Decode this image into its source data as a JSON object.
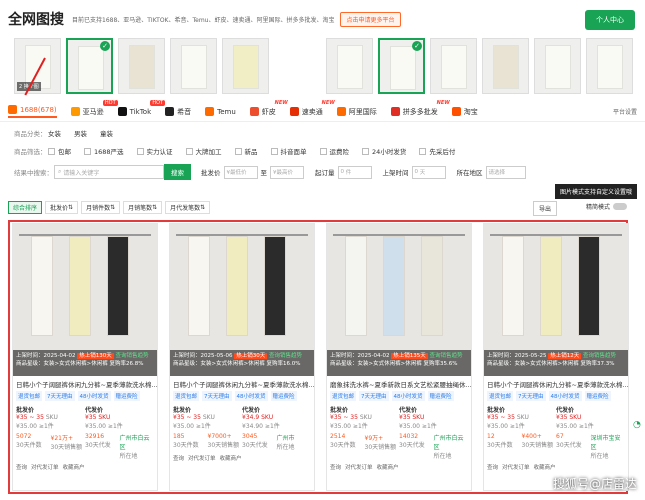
{
  "header": {
    "logo": "全网图搜",
    "tagline": "目前已支持1688、亚马逊、TIKTOK、希音、Temu、虾皮、速卖通、阿里国际、拼多多批发、淘宝",
    "apply": "点击申请更多平台",
    "user_center": "个人中心"
  },
  "thumbs_left": [
    {
      "caption": "",
      "selected": false
    },
    {
      "caption": "",
      "selected": true
    },
    {
      "caption": "",
      "selected": false
    },
    {
      "caption": "",
      "selected": false
    },
    {
      "caption": "",
      "selected": false
    }
  ],
  "thumbs_left_caption": "2 换个图",
  "thumbs_right": [
    {
      "selected": false
    },
    {
      "selected": true
    },
    {
      "selected": false
    },
    {
      "selected": false
    },
    {
      "selected": false
    },
    {
      "selected": false
    },
    {
      "selected": false
    }
  ],
  "platforms": [
    {
      "label": "1688(678)",
      "active": true,
      "badge": "",
      "color": "#ff6a00"
    },
    {
      "label": "亚马逊",
      "badge": "HOT",
      "color": "#ff9900"
    },
    {
      "label": "TikTok",
      "badge": "HOT",
      "color": "#111111"
    },
    {
      "label": "希音",
      "badge": "",
      "color": "#222222"
    },
    {
      "label": "Temu",
      "badge": "",
      "color": "#ff6a00"
    },
    {
      "label": "虾皮",
      "badge": "NEW",
      "color": "#ee4d2d"
    },
    {
      "label": "速卖通",
      "badge": "NEW",
      "color": "#e62e04"
    },
    {
      "label": "阿里国际",
      "badge": "",
      "color": "#ff6a00"
    },
    {
      "label": "拼多多批发",
      "badge": "NEW",
      "color": "#e02e24"
    },
    {
      "label": "淘宝",
      "badge": "",
      "color": "#ff5000"
    }
  ],
  "platform_settings": "平台设置",
  "filters": {
    "category_label": "商品分类：",
    "categories": [
      "女装",
      "男装",
      "童装"
    ],
    "screen_label": "商品筛选：",
    "screens": [
      "包邮",
      "1688严选",
      "实力认证",
      "大牌加工",
      "新品",
      "抖音面单",
      "运费险",
      "24小时发货",
      "先采后付"
    ],
    "search_label": "结果中搜索：",
    "search_placeholder": "请输入关键字",
    "search_button": "搜索",
    "price_label": "批发价",
    "price_min": "¥最低价",
    "price_to": "至",
    "price_max": "¥最高价",
    "moq_label": "起订量",
    "moq_min": "0",
    "moq_unit": "件",
    "time_label": "上架时间",
    "time_min": "0",
    "time_unit": "天",
    "region_label": "所在地区",
    "region_placeholder": "请选择"
  },
  "tooltip": "图片模式支持自定义设置哦",
  "sort": [
    "综合排序",
    "批发价",
    "月销件数",
    "月销笔数",
    "月代发笔数"
  ],
  "export": "导出",
  "fine_mode": "精简模式",
  "cards": [
    {
      "listed": "上架时间：2025-04-02",
      "hot": "热上销130天",
      "trend": "查询销售趋势",
      "stars": "商品星级：女装>女式休闲裤>休闲裤",
      "repurchase": "复购率26.8%",
      "title": "日韩小个子阔腿裤休闲九分裤~夏季薄款洗水棉...",
      "tags": [
        "退货包邮",
        "7天无理由",
        "48小时发货",
        "赠运费险"
      ],
      "price_label": "批发价",
      "price": "¥35 ~ 35",
      "price_sku": "SKU",
      "price_ref": "¥35.00",
      "moq": "≥1件",
      "dropship_label": "代发价",
      "dropship": "¥35",
      "dropship_sku": "SKU",
      "dropship_ref": "¥35.00",
      "dropship_moq": "≥1件",
      "s1": "5072",
      "s1l": "30天件数",
      "s2": "¥21万+",
      "s2l": "30天销售额",
      "s3": "32916",
      "s3l": "30天代发",
      "loc": "广州市白云区",
      "loc2": "所在地",
      "a1": "查询",
      "a2": "对代发订单",
      "a3": "收藏商户"
    },
    {
      "listed": "上架时间：2025-05-06",
      "hot": "热上销30天",
      "trend": "查询销售趋势",
      "stars": "商品星级：女装>女式休闲裤>休闲裤",
      "repurchase": "复购率16.0%",
      "title": "日韩小个子阔腿裤休闲九分裤~夏季薄款洗水棉...",
      "tags": [
        "退货包邮",
        "7天无理由",
        "48小时发货",
        "赠运费险"
      ],
      "price_label": "批发价",
      "price": "¥35 ~ 35",
      "price_sku": "SKU",
      "price_ref": "¥35.00",
      "moq": "≥1件",
      "dropship_label": "代发价",
      "dropship": "¥34.9",
      "dropship_sku": "SKU",
      "dropship_ref": "¥34.90",
      "dropship_moq": "≥1件",
      "s1": "185",
      "s1l": "30天件数",
      "s2": "¥7000+",
      "s2l": "30天销售额",
      "s3": "3045",
      "s3l": "30天代发",
      "loc": "广州市",
      "loc2": "所在地",
      "a1": "查询",
      "a2": "对代发订单",
      "a3": "收藏商户"
    },
    {
      "listed": "上架时间：2025-04-02",
      "hot": "热上销135天",
      "trend": "查询销售趋势",
      "stars": "商品星级：女装>女式休闲裤>休闲裤",
      "repurchase": "复购率35.6%",
      "title": "磨象抹洗水裤~夏季新款日系文艺松紧腰抽绳休...",
      "tags": [
        "退货包邮",
        "7天无理由",
        "48小时发货",
        "赠运费险"
      ],
      "price_label": "批发价",
      "price": "¥35 ~ 35",
      "price_sku": "SKU",
      "price_ref": "¥35.00",
      "moq": "≥1件",
      "dropship_label": "代发价",
      "dropship": "¥35",
      "dropship_sku": "SKU",
      "dropship_ref": "¥35.00",
      "dropship_moq": "≥1件",
      "s1": "2514",
      "s1l": "30天件数",
      "s2": "¥9万+",
      "s2l": "30天销售额",
      "s3": "14032",
      "s3l": "30天代发",
      "loc": "广州市白云区",
      "loc2": "所在地",
      "a1": "查询",
      "a2": "对代发订单",
      "a3": "收藏商户"
    },
    {
      "listed": "上架时间：2025-05-25",
      "hot": "热上销12天",
      "trend": "查询销售趋势",
      "stars": "商品星级：女装>女式休闲裤>休闲裤",
      "repurchase": "复购率37.3%",
      "title": "日韩小个子阔腿裤休闲九分裤~夏季薄款洗水棉...",
      "tags": [
        "退货包邮",
        "7天无理由",
        "48小时发货",
        "赠运费险"
      ],
      "price_label": "批发价",
      "price": "¥35 ~ 35",
      "price_sku": "SKU",
      "price_ref": "¥35.00",
      "moq": "≥1件",
      "dropship_label": "代发价",
      "dropship": "¥35",
      "dropship_sku": "SKU",
      "dropship_ref": "¥35.00",
      "dropship_moq": "≥1件",
      "s1": "12",
      "s1l": "30天件数",
      "s2": "¥400+",
      "s2l": "30天销售额",
      "s3": "67",
      "s3l": "30天代发",
      "loc": "深圳市宝安区",
      "loc2": "所在地",
      "a1": "查询",
      "a2": "对代发订单",
      "a3": "收藏商户"
    }
  ],
  "watermark": "搜狐号@店雷达"
}
